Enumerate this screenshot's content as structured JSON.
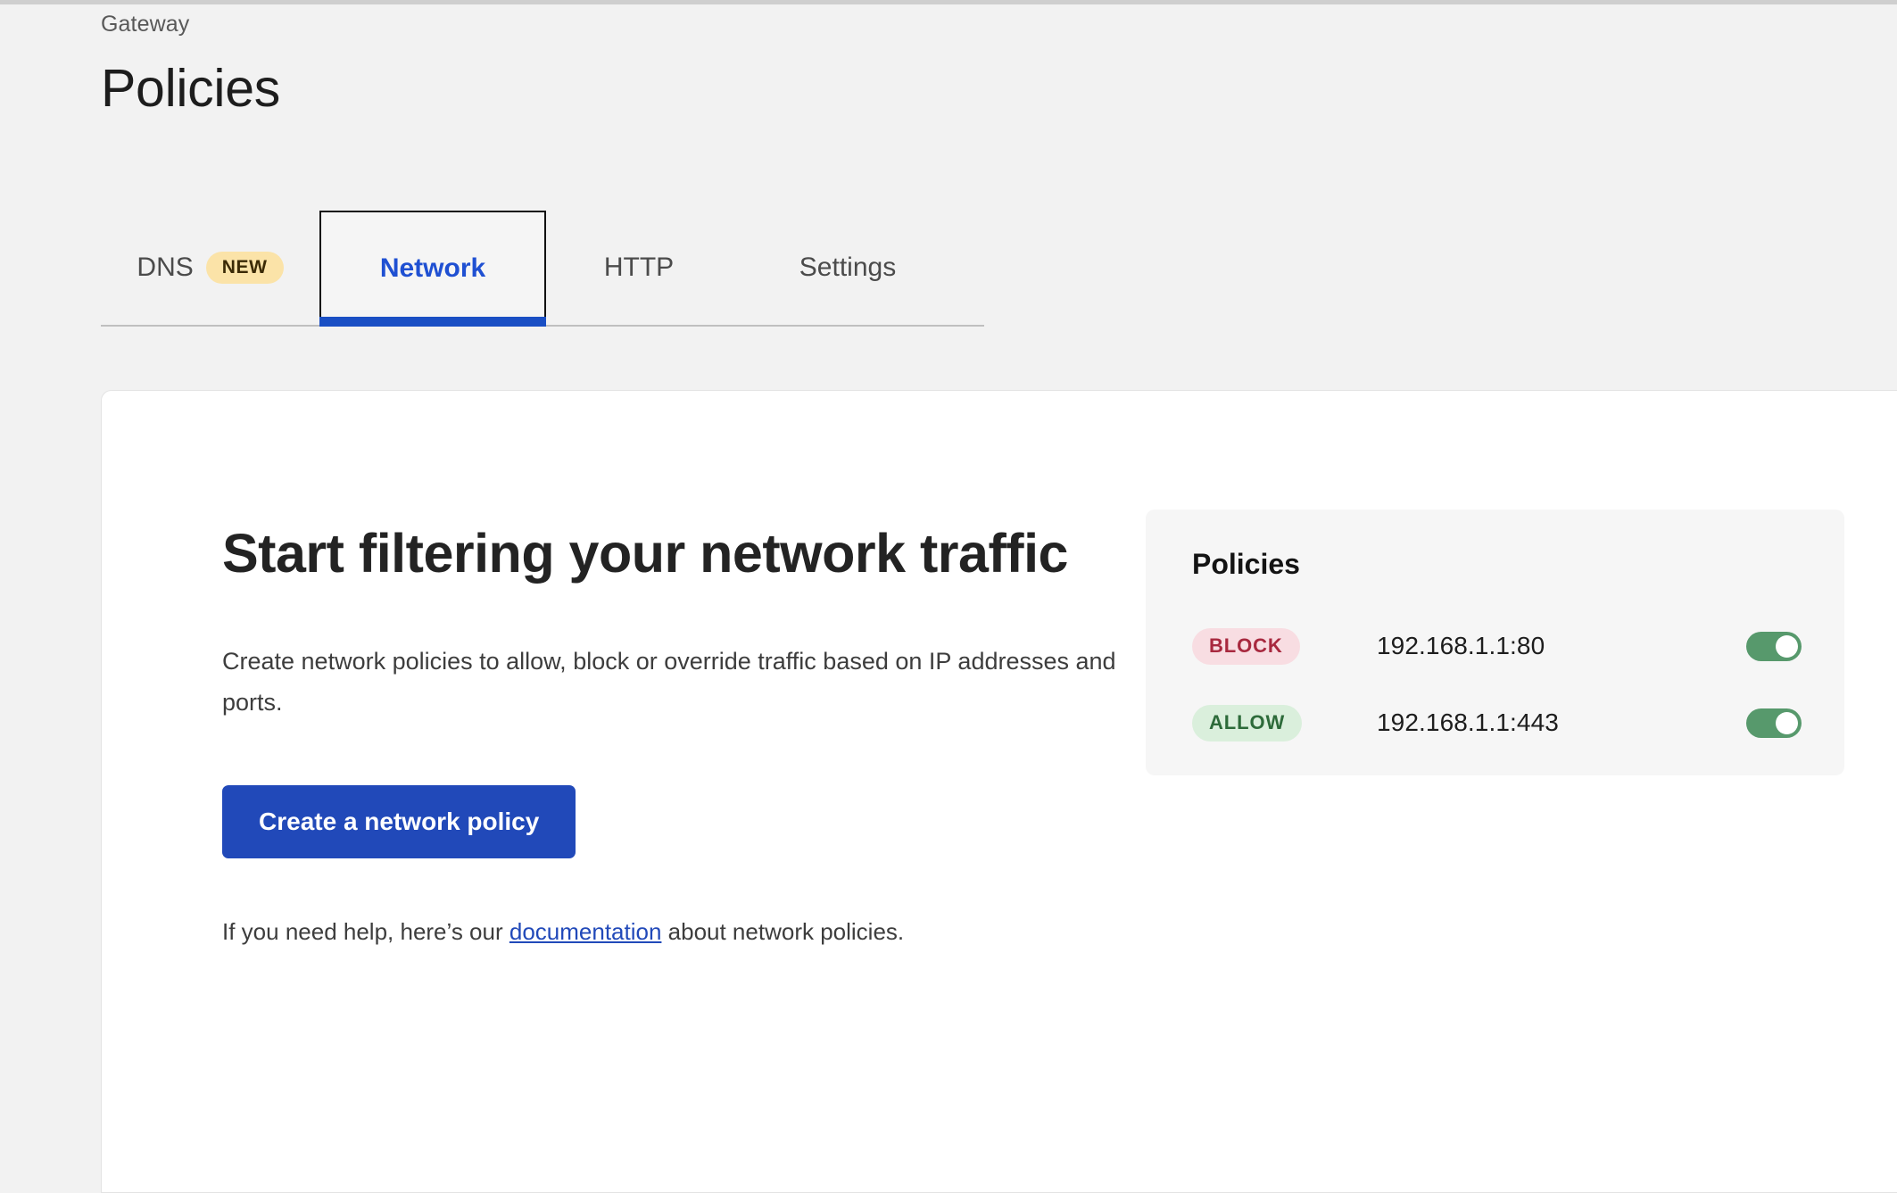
{
  "header": {
    "breadcrumb": "Gateway",
    "title": "Policies"
  },
  "tabs": [
    {
      "label": "DNS",
      "badge": "NEW",
      "active": false
    },
    {
      "label": "Network",
      "active": true
    },
    {
      "label": "HTTP",
      "active": false
    },
    {
      "label": "Settings",
      "active": false
    }
  ],
  "empty_state": {
    "title": "Start filtering your network traffic",
    "description": "Create network policies to allow, block or override traffic based on IP addresses and ports.",
    "button_label": "Create a network policy",
    "help_prefix": "If you need help, here’s our ",
    "help_link": "documentation",
    "help_suffix": " about network policies."
  },
  "policies_preview": {
    "title": "Policies",
    "rows": [
      {
        "action": "BLOCK",
        "target": "192.168.1.1:80",
        "enabled": true
      },
      {
        "action": "ALLOW",
        "target": "192.168.1.1:443",
        "enabled": true
      }
    ]
  },
  "colors": {
    "page_background": "#f2f2f2",
    "card_background": "#ffffff",
    "accent_blue": "#2149b9",
    "tab_active_underline": "#1a4fc4",
    "badge_new_bg": "#fbe3a8",
    "badge_new_text": "#3b2a05",
    "pill_block_bg": "#f8dde2",
    "pill_block_text": "#a8293f",
    "pill_allow_bg": "#daefdc",
    "pill_allow_text": "#2d6b3a",
    "toggle_on": "#57996c"
  }
}
